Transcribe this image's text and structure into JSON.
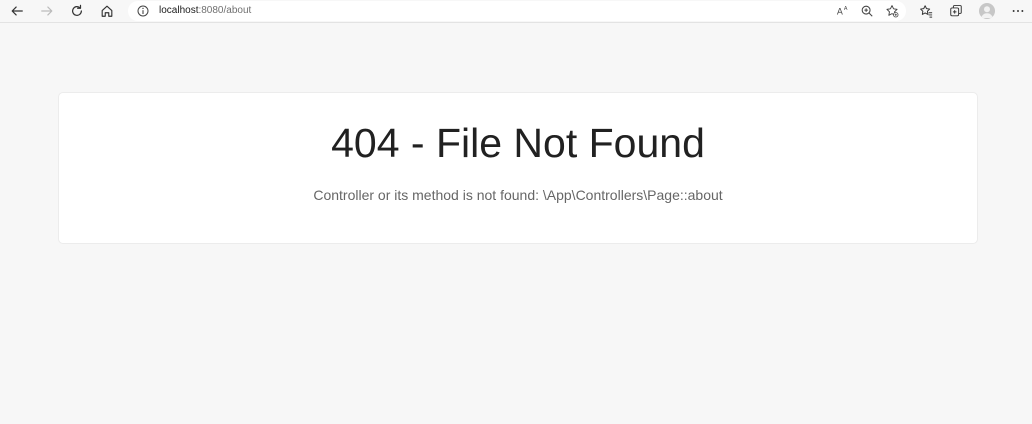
{
  "browser": {
    "url_host": "localhost",
    "url_rest": ":8080/about",
    "icons": {
      "back": "arrow-left-icon",
      "forward": "arrow-right-icon",
      "refresh": "refresh-icon",
      "home": "home-icon",
      "info": "info-icon",
      "read_aloud": "read-aloud-icon",
      "zoom": "zoom-icon",
      "favorite": "add-favorite-icon",
      "favorites": "favorites-icon",
      "collections": "collections-icon",
      "profile": "profile-avatar",
      "menu": "more-menu-icon"
    }
  },
  "page": {
    "title": "404 - File Not Found",
    "message": "Controller or its method is not found: \\App\\Controllers\\Page::about"
  }
}
